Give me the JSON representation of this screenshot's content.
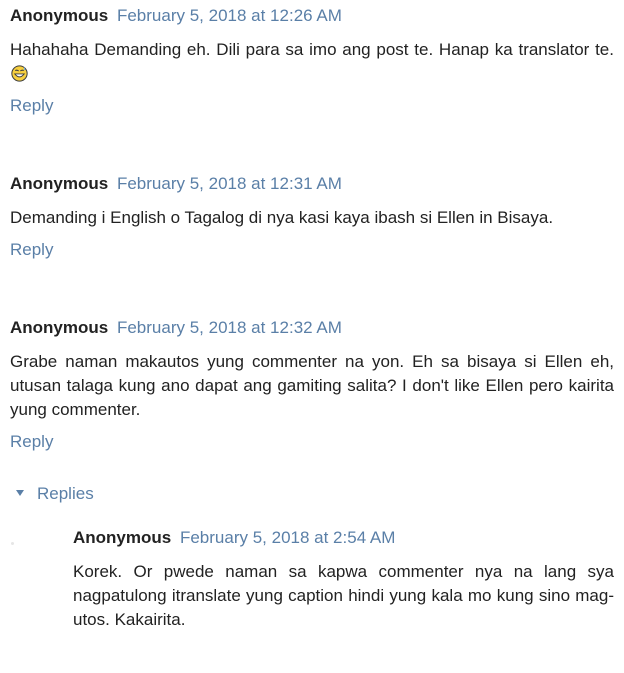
{
  "comments": [
    {
      "author": "Anonymous",
      "date": "February 5, 2018 at 12:26 AM",
      "text": "Hahahaha Demanding eh. Dili para sa imo ang post te. Hanap ka translator te.",
      "emoji": "grinning-sweat-face",
      "reply_label": "Reply"
    },
    {
      "author": "Anonymous",
      "date": "February 5, 2018 at 12:31 AM",
      "text": "Demanding i English o Tagalog di nya kasi kaya ibash si Ellen in Bisaya.",
      "reply_label": "Reply"
    },
    {
      "author": "Anonymous",
      "date": "February 5, 2018 at 12:32 AM",
      "text": "Grabe naman makautos yung commenter na yon. Eh sa bisaya si Ellen eh, utusan talaga kung ano dapat ang gamiting salita? I don't like Ellen pero kairita yung commenter.",
      "reply_label": "Reply"
    }
  ],
  "replies_toggle": {
    "label": "Replies",
    "icon": "caret-down-icon"
  },
  "nested_reply": {
    "author": "Anonymous",
    "date": "February 5, 2018 at 2:54 AM",
    "text": "Korek. Or pwede naman sa kapwa commenter nya na lang sya nagpatulong itranslate yung caption hindi yung kala mo kung sino mag-utos. Kakairita."
  },
  "colors": {
    "link": "#5a7fa7",
    "text": "#222222",
    "background": "#ffffff"
  }
}
